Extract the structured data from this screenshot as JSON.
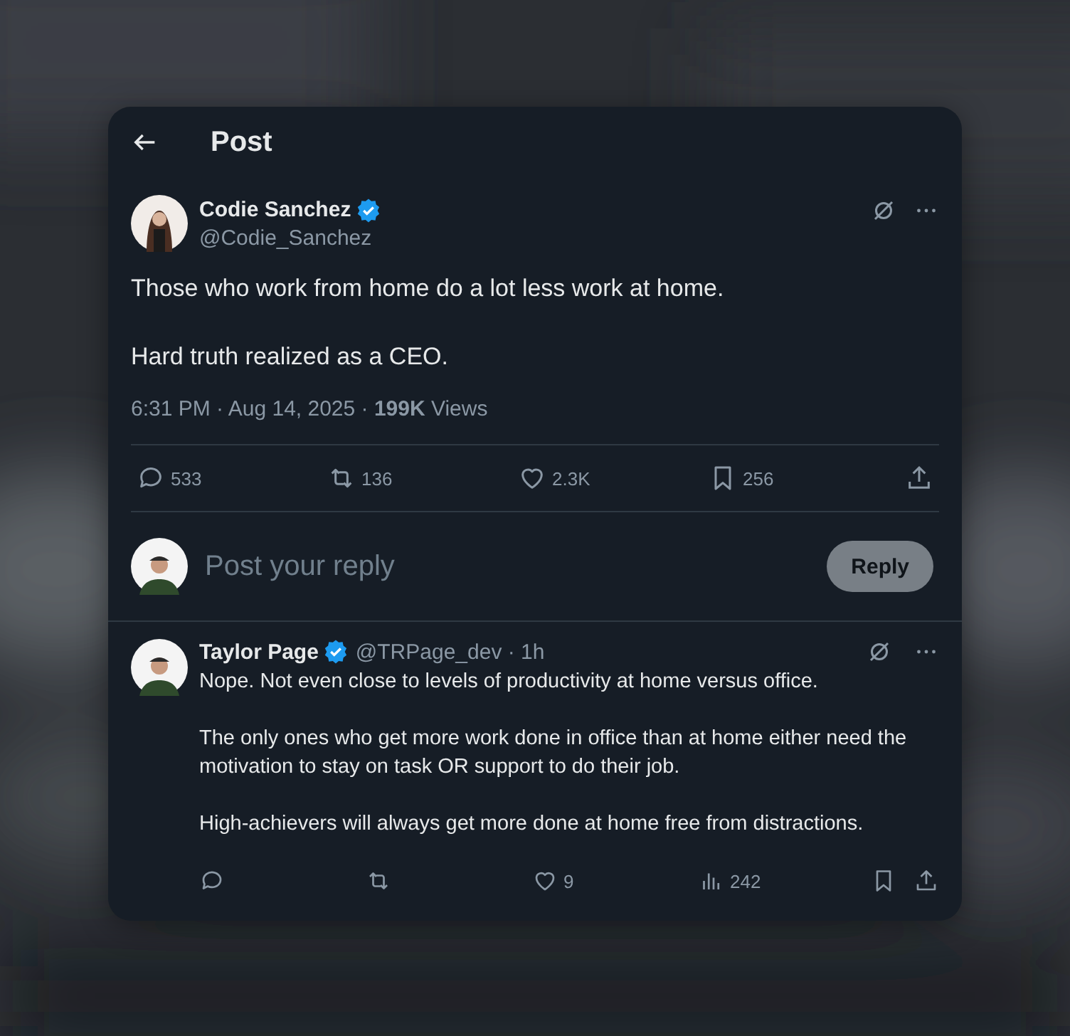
{
  "header": {
    "title": "Post"
  },
  "post": {
    "author": {
      "name": "Codie Sanchez",
      "handle": "@Codie_Sanchez",
      "verified": true
    },
    "paragraphs": [
      "Those who work from home do a lot less work at home.",
      "Hard truth realized as a CEO."
    ],
    "meta": "6:31 PM · Aug 14, 2025 · **199K** Views",
    "actions": [
      {
        "kind": "reply",
        "count": "533"
      },
      {
        "kind": "repost",
        "count": "136"
      },
      {
        "kind": "like",
        "count": "2.3K"
      },
      {
        "kind": "bookmark",
        "count": "256"
      },
      {
        "kind": "share"
      }
    ]
  },
  "composer": {
    "placeholder": "Post your reply",
    "button": "Reply"
  },
  "reply": {
    "author": {
      "name": "Taylor Page",
      "handle": "@TRPage_dev · 1h",
      "verified": true
    },
    "paragraphs": [
      "Nope. Not even close to levels of productivity at home versus office.",
      "The only ones who get more work done in office than at home either need the motivation to stay on task OR support to do their job.",
      "High-achievers will always get more done at home free from distractions."
    ],
    "actions": [
      {
        "kind": "reply"
      },
      {
        "kind": "repost"
      },
      {
        "kind": "like",
        "count": "9"
      },
      {
        "kind": "views",
        "count": "242"
      },
      {
        "kind": "bookmark"
      },
      {
        "kind": "share"
      }
    ]
  }
}
